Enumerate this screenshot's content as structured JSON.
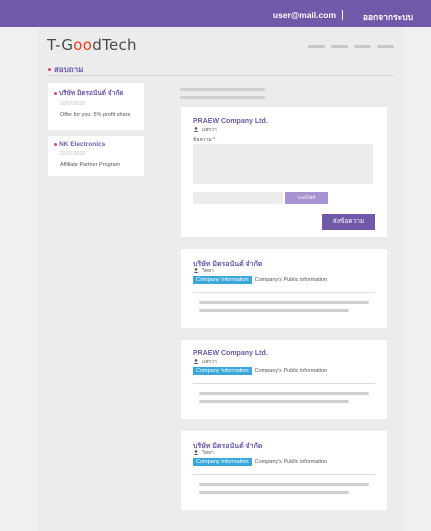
{
  "header": {
    "email": "user@mail.com",
    "logout_label": "ออกจากระบบ"
  },
  "logo": {
    "prefix": "T-G",
    "accent": "oo",
    "suffix": "dTech"
  },
  "section": {
    "title": "สอบถาม"
  },
  "sidebar": {
    "items": [
      {
        "name": "บริษัท มิตรอนันต์ จำกัด",
        "date": "10/07/2018",
        "desc": "Offer for you: 5% profit share"
      },
      {
        "name": "NK Electronics",
        "date": "10/07/2018",
        "desc": "Affiliate Partner Program"
      }
    ]
  },
  "compose": {
    "company": "PRAEW Company Ltd.",
    "person": "แพรวา",
    "message_label": "ข้อความ",
    "required_mark": "*",
    "attach_label": "แนบไฟล์",
    "send_label": "ส่งข้อความ"
  },
  "messages": [
    {
      "company": "บริษัท มิตรอนันต์ จำกัด",
      "person": "วิทยา",
      "tag": "Company Information",
      "tag_text": "Company's Public information"
    },
    {
      "company": "PRAEW Company Ltd.",
      "person": "แพรวา",
      "tag": "Company Information",
      "tag_text": "Company's Public information"
    },
    {
      "company": "บริษัท มิตรอนันต์ จำกัด",
      "person": "วิทยา",
      "tag": "Company Information",
      "tag_text": "Company's Public information"
    }
  ],
  "colors": {
    "brand": "#6f59a8",
    "accent_red": "#e8401c",
    "tag_blue": "#3ba6da"
  }
}
